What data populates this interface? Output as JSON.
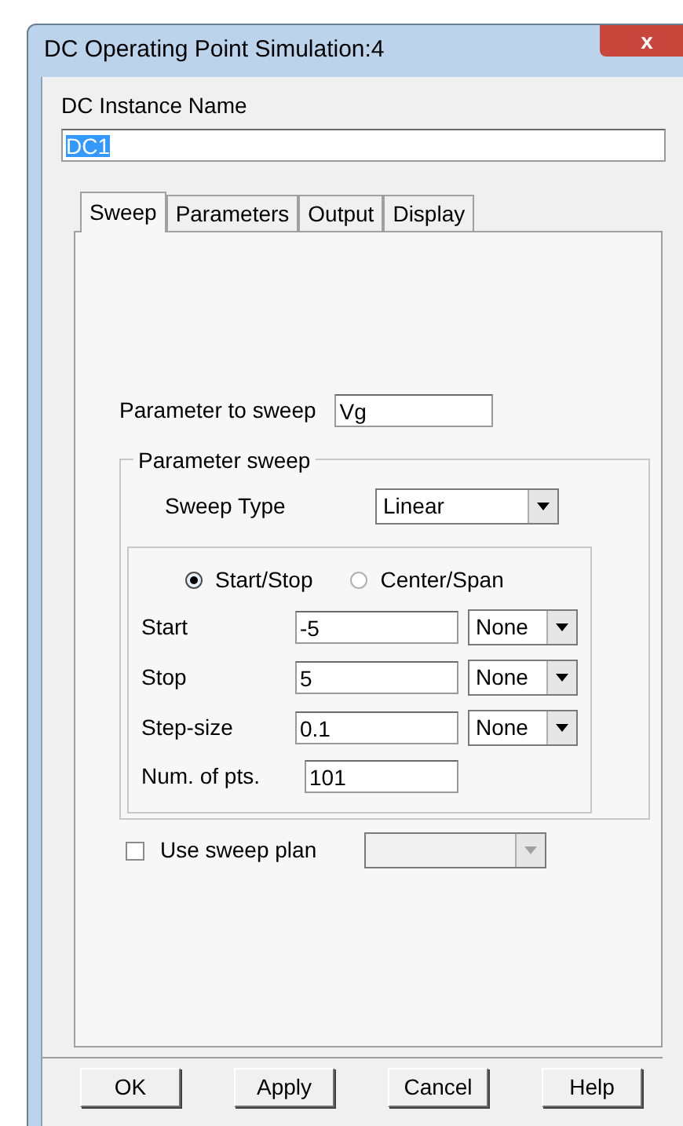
{
  "window": {
    "title": "DC Operating Point Simulation:4",
    "close": "x"
  },
  "instance_name": {
    "label": "DC Instance Name",
    "value": "DC1",
    "selected": true
  },
  "tabs": [
    {
      "label": "Sweep",
      "selected": true
    },
    {
      "label": "Parameters",
      "selected": false
    },
    {
      "label": "Output",
      "selected": false
    },
    {
      "label": "Display",
      "selected": false
    }
  ],
  "parameter_to_sweep": {
    "label": "Parameter to sweep",
    "value": "Vg"
  },
  "parameter_sweep": {
    "title": "Parameter sweep",
    "sweep_type": {
      "label": "Sweep Type",
      "value": "Linear"
    },
    "modes": [
      {
        "label": "Start/Stop",
        "selected": true
      },
      {
        "label": "Center/Span",
        "selected": false
      }
    ],
    "rows": [
      {
        "label": "Start",
        "value": "-5",
        "unit": "None"
      },
      {
        "label": "Stop",
        "value": "5",
        "unit": "None"
      },
      {
        "label": "Step-size",
        "value": "0.1",
        "unit": "None"
      },
      {
        "label": "Num. of pts.",
        "value": "101"
      }
    ]
  },
  "use_sweep_plan": {
    "label": "Use sweep plan",
    "checked": false,
    "disabled": true
  },
  "buttons": [
    "OK",
    "Apply",
    "Cancel",
    "Help"
  ]
}
